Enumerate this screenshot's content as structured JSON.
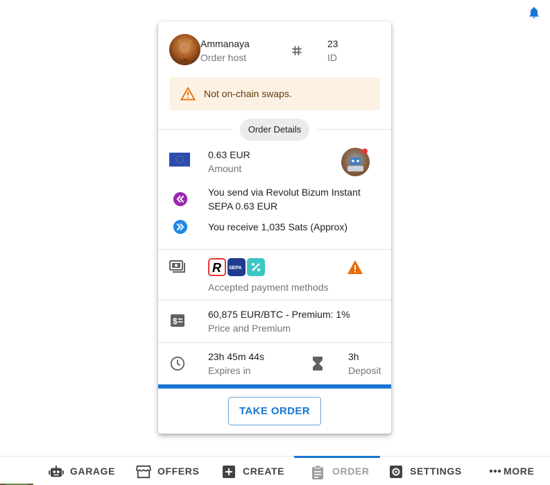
{
  "order": {
    "host_name": "Ammanaya",
    "host_label": "Order host",
    "id_value": "23",
    "id_label": "ID",
    "warning": "Not on-chain swaps.",
    "details_chip": "Order Details",
    "amount_value": "0.63 EUR",
    "amount_label": "Amount",
    "send_text_line1": "You send via Revolut Bizum Instant",
    "send_text_line2": "SEPA 0.63 EUR",
    "receive_text": "You receive 1,035 Sats (Approx)",
    "payment_methods_label": "Accepted payment methods",
    "payment_methods": [
      "Revolut",
      "SEPA",
      "Bizum"
    ],
    "price_value": "60,875 EUR/BTC - Premium: 1%",
    "price_label": "Price and Premium",
    "expires_value": "23h 45m 44s",
    "expires_label": "Expires in",
    "deposit_value": "3h",
    "deposit_label": "Deposit",
    "expiry_progress_percent": 100,
    "take_button": "TAKE ORDER"
  },
  "nav": {
    "items": [
      {
        "label": "GARAGE",
        "icon": "robot-icon"
      },
      {
        "label": "OFFERS",
        "icon": "storefront-icon"
      },
      {
        "label": "CREATE",
        "icon": "add-box-icon"
      },
      {
        "label": "ORDER",
        "icon": "clipboard-icon",
        "active": true
      },
      {
        "label": "SETTINGS",
        "icon": "gear-icon"
      },
      {
        "label": "MORE",
        "icon": "more-horiz-icon"
      }
    ]
  },
  "colors": {
    "accent": "#1976d2",
    "warning_bg": "#fdf1e4",
    "warning_icon": "#ed6c02",
    "send_icon": "#9c27b0",
    "receive_icon": "#1e88e5",
    "disabled_nav": "#9e9e9e"
  }
}
